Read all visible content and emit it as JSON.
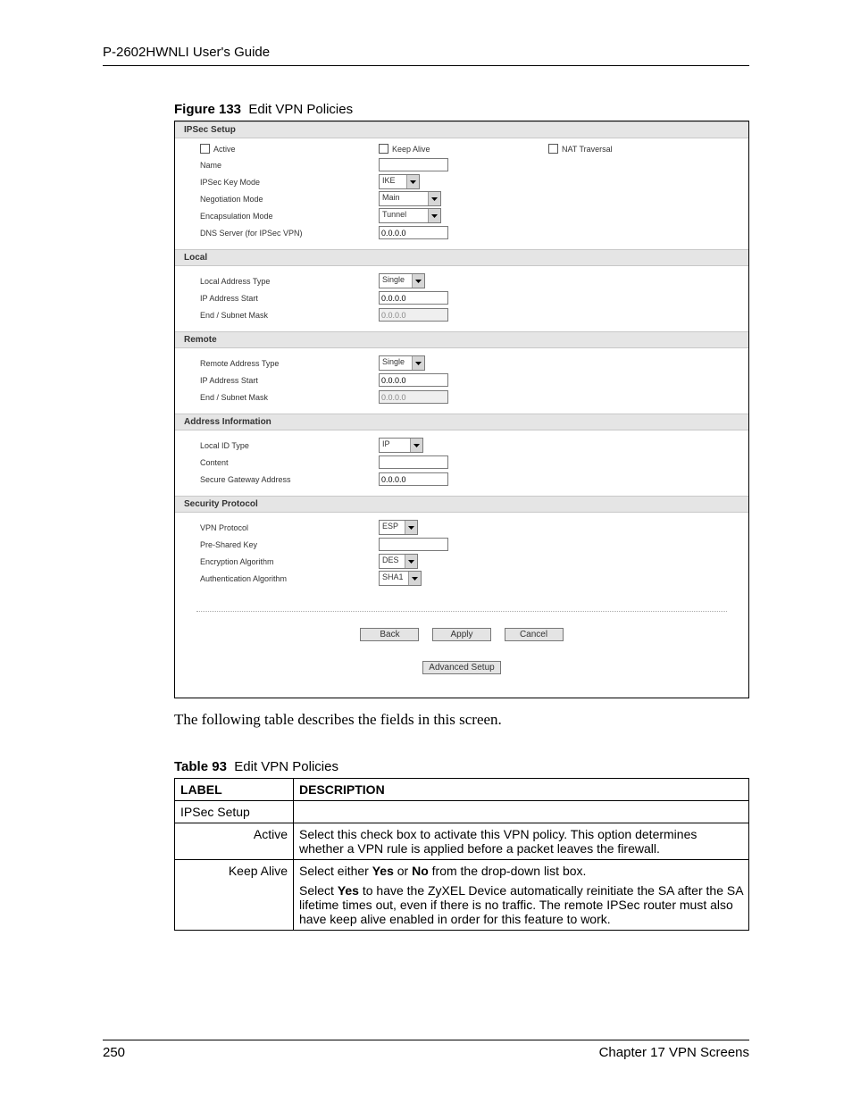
{
  "doc": {
    "header": "P-2602HWNLI User's Guide",
    "figure_label": "Figure 133",
    "figure_title": "Edit VPN Policies",
    "intro": "The following table describes the fields in this screen.",
    "table_label": "Table 93",
    "table_title": "Edit VPN Policies",
    "page_num": "250",
    "chapter": "Chapter 17 VPN Screens"
  },
  "form": {
    "sections": {
      "ipsec": "IPSec Setup",
      "local": "Local",
      "remote": "Remote",
      "addr": "Address Information",
      "sec": "Security Protocol"
    },
    "ipsec": {
      "active": "Active",
      "keep_alive": "Keep Alive",
      "nat_trav": "NAT Traversal",
      "name": "Name",
      "name_val": "",
      "key_mode": "IPSec Key Mode",
      "key_mode_val": "IKE",
      "neg_mode": "Negotiation Mode",
      "neg_mode_val": "Main",
      "encap_mode": "Encapsulation Mode",
      "encap_mode_val": "Tunnel",
      "dns": "DNS Server (for IPSec VPN)",
      "dns_val": "0.0.0.0"
    },
    "local": {
      "addr_type": "Local Address Type",
      "addr_type_val": "Single",
      "ip_start": "IP Address Start",
      "ip_start_val": "0.0.0.0",
      "subnet": "End / Subnet Mask",
      "subnet_val": "0.0.0.0"
    },
    "remote": {
      "addr_type": "Remote Address Type",
      "addr_type_val": "Single",
      "ip_start": "IP Address Start",
      "ip_start_val": "0.0.0.0",
      "subnet": "End / Subnet Mask",
      "subnet_val": "0.0.0.0"
    },
    "addr": {
      "local_id": "Local ID Type",
      "local_id_val": "IP",
      "content": "Content",
      "content_val": "",
      "sgw": "Secure Gateway Address",
      "sgw_val": "0.0.0.0"
    },
    "sec": {
      "proto": "VPN Protocol",
      "proto_val": "ESP",
      "psk": "Pre-Shared Key",
      "psk_val": "",
      "enc": "Encryption Algorithm",
      "enc_val": "DES",
      "auth": "Authentication Algorithm",
      "auth_val": "SHA1"
    },
    "buttons": {
      "back": "Back",
      "apply": "Apply",
      "cancel": "Cancel",
      "advanced": "Advanced Setup"
    }
  },
  "table": {
    "h1": "LABEL",
    "h2": "DESCRIPTION",
    "r1_l": "IPSec Setup",
    "r1_d": "",
    "r2_l": "Active",
    "r2_d": "Select this check box to activate this VPN policy. This option determines whether a VPN rule is applied before a packet leaves the firewall.",
    "r3_l": "Keep Alive",
    "r3_d_a": "Select either ",
    "r3_d_b": "Yes",
    "r3_d_c": " or ",
    "r3_d_d": "No",
    "r3_d_e": " from the drop-down list box.",
    "r3_d2_a": "Select ",
    "r3_d2_b": "Yes",
    "r3_d2_c": " to have the ZyXEL Device automatically reinitiate the SA after the SA lifetime times out, even if there is no traffic. The remote IPSec router must also have keep alive enabled in order for this feature to work."
  }
}
